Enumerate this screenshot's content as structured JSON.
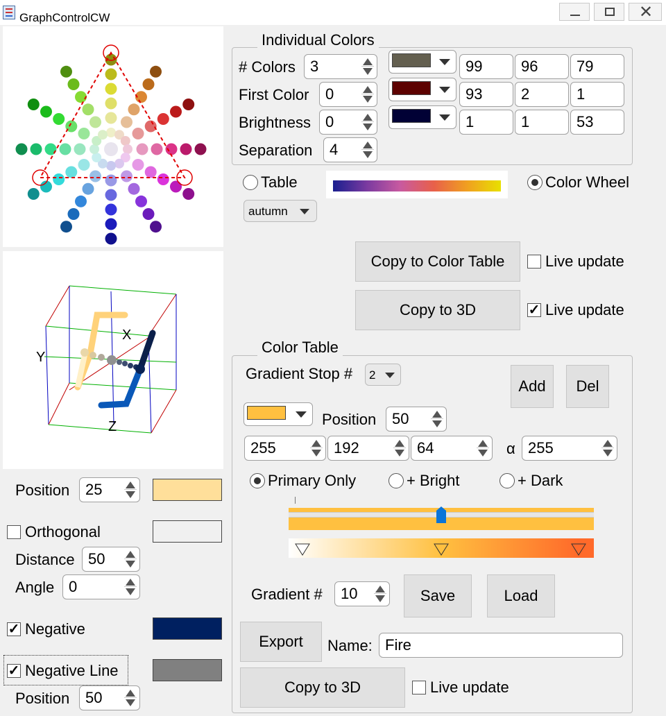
{
  "window": {
    "title": "GraphControlCW"
  },
  "individual_colors": {
    "title": "Individual Colors",
    "num_colors_label": "# Colors",
    "num_colors": "3",
    "first_color_label": "First Color",
    "first_color": "0",
    "brightness_label": "Brightness",
    "brightness": "0",
    "separation_label": "Separation",
    "separation": "4",
    "colors": [
      {
        "hex": "#635f4f",
        "r": "99",
        "g": "96",
        "b": "79"
      },
      {
        "hex": "#5d0201",
        "r": "93",
        "g": "2",
        "b": "1"
      },
      {
        "hex": "#010135",
        "r": "1",
        "g": "1",
        "b": "53"
      }
    ]
  },
  "mode": {
    "table_label": "Table",
    "color_wheel_label": "Color Wheel",
    "table_selected": false,
    "colormap_select": "autumn"
  },
  "copy_buttons": {
    "copy_to_color_table": "Copy to Color Table",
    "copy_to_3d": "Copy to 3D",
    "live_update_1": "Live update",
    "live_update_1_checked": false,
    "live_update_2": "Live update",
    "live_update_2_checked": true
  },
  "plot3d": {
    "x_label": "X",
    "y_label": "Y",
    "z_label": "Z"
  },
  "left_controls": {
    "position_label": "Position",
    "position": "25",
    "position_color": "#ffdf9a",
    "orthogonal_label": "Orthogonal",
    "orthogonal_checked": false,
    "orthogonal_color": "#f0f0f0",
    "distance_label": "Distance",
    "distance": "50",
    "angle_label": "Angle",
    "angle": "0",
    "negative_label": "Negative",
    "negative_checked": true,
    "negative_color": "#002060",
    "negative_line_label": "Negative Line",
    "negative_line_checked": true,
    "negative_line_color": "#808080",
    "position2_label": "Position",
    "position2": "50"
  },
  "color_table": {
    "title": "Color Table",
    "gradient_stop_label": "Gradient Stop #",
    "gradient_stop": "2",
    "add_label": "Add",
    "del_label": "Del",
    "stop_color": "#ffc040",
    "position_label": "Position",
    "position": "50",
    "r": "255",
    "g": "192",
    "b": "64",
    "alpha_label": "α",
    "alpha": "255",
    "primary_only_label": "Primary Only",
    "plus_bright_label": "+ Bright",
    "plus_dark_label": "+ Dark",
    "slider_value_percent": 50,
    "gradient_num_label": "Gradient #",
    "gradient_num": "10",
    "save_label": "Save",
    "load_label": "Load",
    "export_label": "Export",
    "name_label": "Name:",
    "name_value": "Fire",
    "copy_to_3d": "Copy to 3D",
    "live_update": "Live update",
    "live_update_checked": false
  }
}
